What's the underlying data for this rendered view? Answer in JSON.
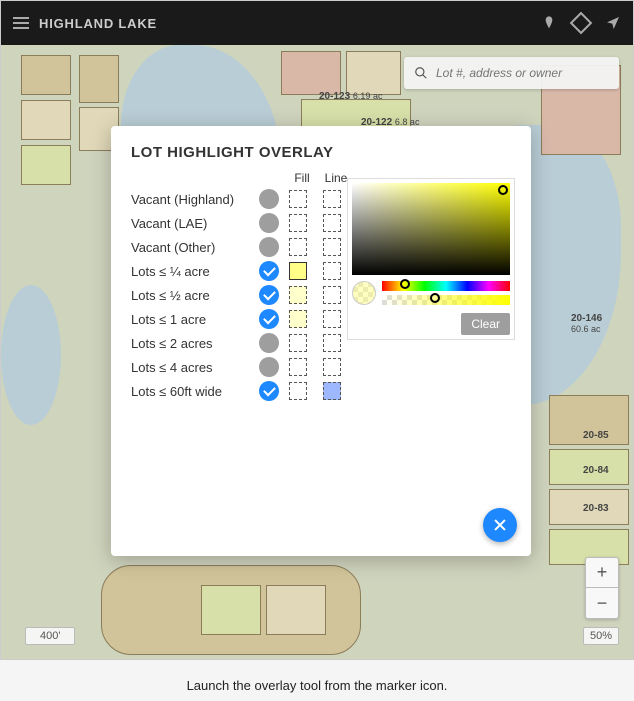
{
  "header": {
    "title": "HIGHLAND LAKE",
    "icons": [
      "marker-icon",
      "diamond-icon",
      "locate-icon"
    ]
  },
  "search": {
    "placeholder": "Lot #, address or owner"
  },
  "modal": {
    "title": "LOT HIGHLIGHT OVERLAY",
    "columns": {
      "fill": "Fill",
      "line": "Line"
    },
    "rows": [
      {
        "label": "Vacant (Highland)",
        "on": false,
        "fill": "none",
        "line": "none"
      },
      {
        "label": "Vacant (LAE)",
        "on": false,
        "fill": "none",
        "line": "none"
      },
      {
        "label": "Vacant (Other)",
        "on": false,
        "fill": "none",
        "line": "none"
      },
      {
        "label": "Lots ≤ ¼ acre",
        "on": true,
        "fill": "yellow-strong",
        "line": "none"
      },
      {
        "label": "Lots ≤ ½ acre",
        "on": true,
        "fill": "yellow-light",
        "line": "none"
      },
      {
        "label": "Lots ≤ 1 acre",
        "on": true,
        "fill": "yellow-light",
        "line": "none"
      },
      {
        "label": "Lots ≤ 2 acres",
        "on": false,
        "fill": "none",
        "line": "none"
      },
      {
        "label": "Lots ≤ 4 acres",
        "on": false,
        "fill": "none",
        "line": "none"
      },
      {
        "label": "Lots ≤ 60ft wide",
        "on": true,
        "fill": "none",
        "line": "blue"
      }
    ],
    "picker": {
      "hue_hex": "#ffff00",
      "clear_label": "Clear"
    },
    "close_label": "Close"
  },
  "map": {
    "lots": [
      {
        "id": "20-123",
        "size": "6.19 ac"
      },
      {
        "id": "20-122",
        "size": "6.8 ac"
      },
      {
        "id": "20-146",
        "size": "60.6 ac"
      },
      {
        "id": "20-85",
        "size": ""
      },
      {
        "id": "20-84",
        "size": ""
      },
      {
        "id": "20-83",
        "size": ""
      }
    ],
    "scale": "400'",
    "zoom": "50%"
  },
  "caption": "Launch the overlay tool from the marker icon."
}
